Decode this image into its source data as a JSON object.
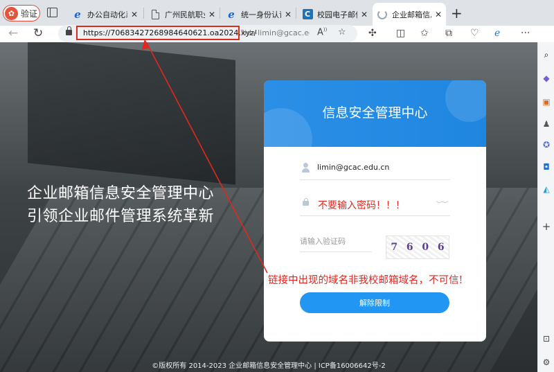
{
  "browser": {
    "verify_button": {
      "label": "验证",
      "badge": "✿"
    },
    "tabs": [
      {
        "title": "办公自动化系",
        "icon": "ie-icon",
        "close": "✕"
      },
      {
        "title": "广州民航职业",
        "icon": "doc-icon",
        "close": "✕"
      },
      {
        "title": "统一身份认证",
        "icon": "ie-icon",
        "close": "✕"
      },
      {
        "title": "校园电子邮件",
        "icon": "c-icon",
        "close": "✕"
      },
      {
        "title": "企业邮箱信息",
        "icon": "loading-icon",
        "close": "✕",
        "active": true
      }
    ],
    "new_tab": "+",
    "address": {
      "url_highlighted": "https://70683427268984640621.oa2024.xyz/",
      "url_rest": "?id=limin@gcac.ed..."
    }
  },
  "page": {
    "hero_lines": [
      "企业邮箱信息安全管理中心",
      "引领企业邮件管理系统革新"
    ],
    "card": {
      "title": "信息安全管理中心",
      "username": "limin@gcac.edu.cn",
      "password_note": "不要输入密码！！！",
      "captcha_placeholder": "请输入验证码",
      "captcha_chars": [
        "7",
        "6",
        "0",
        "6"
      ],
      "submit_label": "解除限制"
    },
    "footer": "©版权所有 2014-2023 企业邮箱信息安全管理中心 | ICP备16006642号-2"
  },
  "annotations": {
    "domain_warning": "链接中出现的域名非我校邮箱域名，不可信!",
    "arrow_color": "#e0281f"
  }
}
